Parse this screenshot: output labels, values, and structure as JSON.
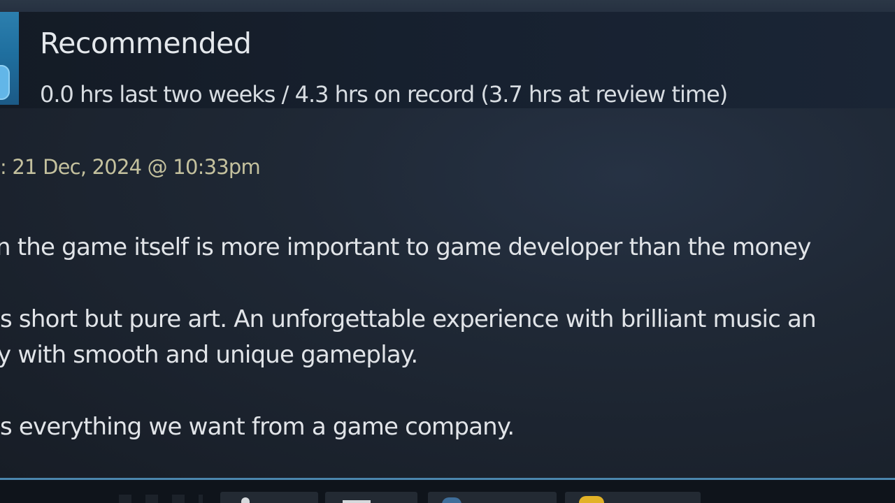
{
  "review": {
    "verdict": "Recommended",
    "hours": "0.0 hrs last two weeks / 4.3 hrs on record (3.7 hrs at review time)",
    "posted": ": 21 Dec, 2024 @ 10:33pm",
    "body_lines": [
      "n the game itself is more important to game developer than the money",
      "s short but pure art. An unforgettable experience with brilliant music an",
      "y with smooth and unique gameplay.",
      "s everything we want from a game company."
    ]
  },
  "footer": {
    "buttons": [
      {
        "icon": "thumbs-up-icon"
      },
      {
        "icon": "thumbs-down-icon"
      },
      {
        "icon": "funny-icon"
      },
      {
        "icon": "award-icon"
      }
    ]
  },
  "colors": {
    "accent_divider": "#4b86ad",
    "posted_text": "#c4c19e",
    "thumb_tile": "#1f6f9f"
  }
}
